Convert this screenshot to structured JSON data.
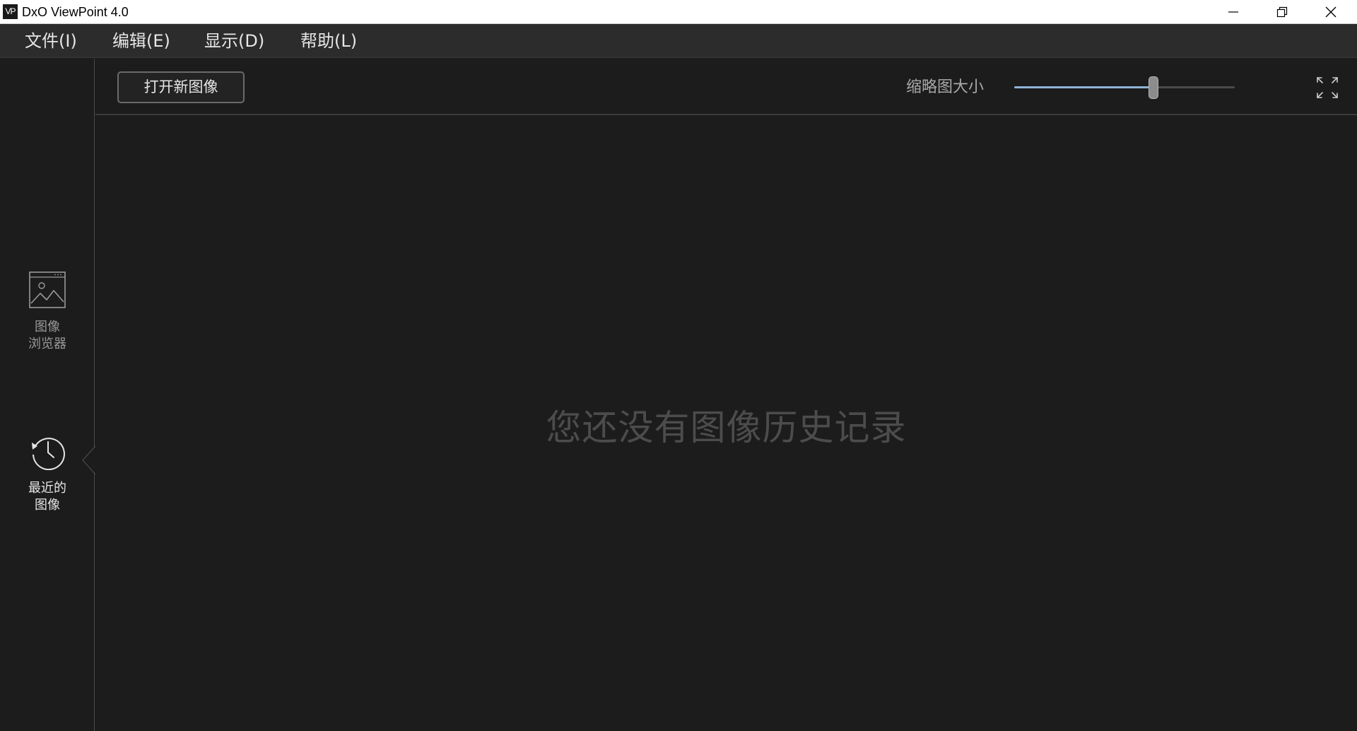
{
  "window": {
    "logo_text": "VP",
    "title": "DxO ViewPoint 4.0",
    "controls": [
      "minimize-icon",
      "restore-icon",
      "close-icon"
    ]
  },
  "menu": {
    "items": [
      {
        "label": "文件(I)"
      },
      {
        "label": "编辑(E)"
      },
      {
        "label": "显示(D)"
      },
      {
        "label": "帮助(L)"
      }
    ]
  },
  "sidebar": {
    "items": [
      {
        "label_line1": "图像",
        "label_line2": "浏览器",
        "icon": "image-browser-icon",
        "active": false
      },
      {
        "label_line1": "最近的",
        "label_line2": "图像",
        "icon": "history-clock-icon",
        "active": true
      }
    ]
  },
  "toolbar": {
    "open_button": "打开新图像",
    "thumbnail_size_label": "缩略图大小",
    "thumbnail_size_value": 0.63,
    "fullscreen_icon": "fullscreen-expand-icon"
  },
  "main": {
    "empty_message": "您还没有图像历史记录"
  },
  "colors": {
    "background": "#1c1c1c",
    "menubar": "#2c2c2c",
    "accent": "#8fb3d6",
    "empty_text": "#4c4c4c"
  }
}
